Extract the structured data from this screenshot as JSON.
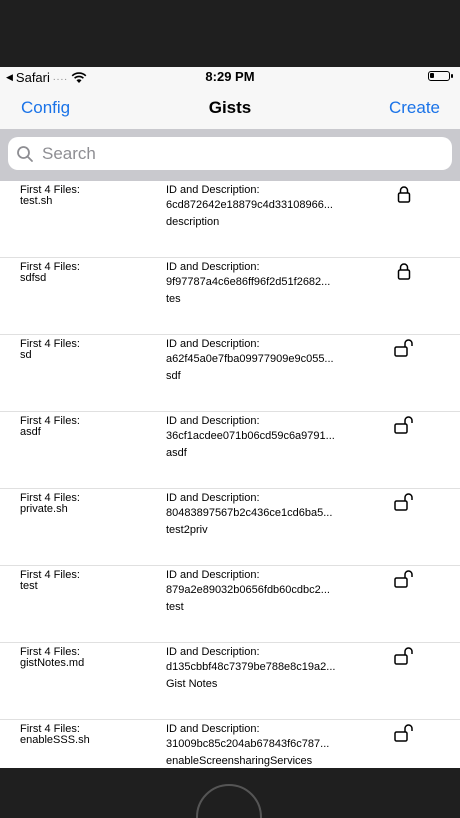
{
  "status_bar": {
    "carrier": "Safari",
    "signal": "....",
    "time": "8:29 PM",
    "battery_level": 0.25
  },
  "nav": {
    "left_label": "Config",
    "title": "Gists",
    "right_label": "Create"
  },
  "search": {
    "placeholder": "Search",
    "value": ""
  },
  "rows": [
    {
      "files_label": "First 4 Files:",
      "files": "test.sh",
      "id_label": "ID and Description:",
      "id": "6cd872642e18879c4d33108966...",
      "description": "description",
      "locked": true
    },
    {
      "files_label": "First 4 Files:",
      "files": "sdfsd",
      "id_label": "ID and Description:",
      "id": "9f97787a4c6e86ff96f2d51f2682...",
      "description": "tes",
      "locked": true
    },
    {
      "files_label": "First 4 Files:",
      "files": "sd",
      "id_label": "ID and Description:",
      "id": "a62f45a0e7fba09977909e9c055...",
      "description": "sdf",
      "locked": false
    },
    {
      "files_label": "First 4 Files:",
      "files": "asdf",
      "id_label": "ID and Description:",
      "id": "36cf1acdee071b06cd59c6a9791...",
      "description": "asdf",
      "locked": false
    },
    {
      "files_label": "First 4 Files:",
      "files": "private.sh",
      "id_label": "ID and Description:",
      "id": "80483897567b2c436ce1cd6ba5...",
      "description": "test2priv",
      "locked": false
    },
    {
      "files_label": "First 4 Files:",
      "files": "test",
      "id_label": "ID and Description:",
      "id": "879a2e89032b0656fdb60cdbc2...",
      "description": "test",
      "locked": false
    },
    {
      "files_label": "First 4 Files:",
      "files": "gistNotes.md",
      "id_label": "ID and Description:",
      "id": "d135cbbf48c7379be788e8c19a2...",
      "description": "Gist Notes",
      "locked": false
    },
    {
      "files_label": "First 4 Files:",
      "files": "enableSSS.sh",
      "id_label": "ID and Description:",
      "id": "31009bc85c204ab67843f6c787...",
      "description": "enableScreensharingServices",
      "locked": false
    }
  ],
  "icons": {
    "search": "search-icon",
    "lock_closed": "lock-closed-icon",
    "lock_open": "lock-open-icon",
    "wifi": "wifi-icon",
    "battery": "battery-icon"
  },
  "colors": {
    "accent": "#1a73e8",
    "search_bar_bg": "#c9c9ce",
    "nav_bg": "#f7f7f7"
  }
}
